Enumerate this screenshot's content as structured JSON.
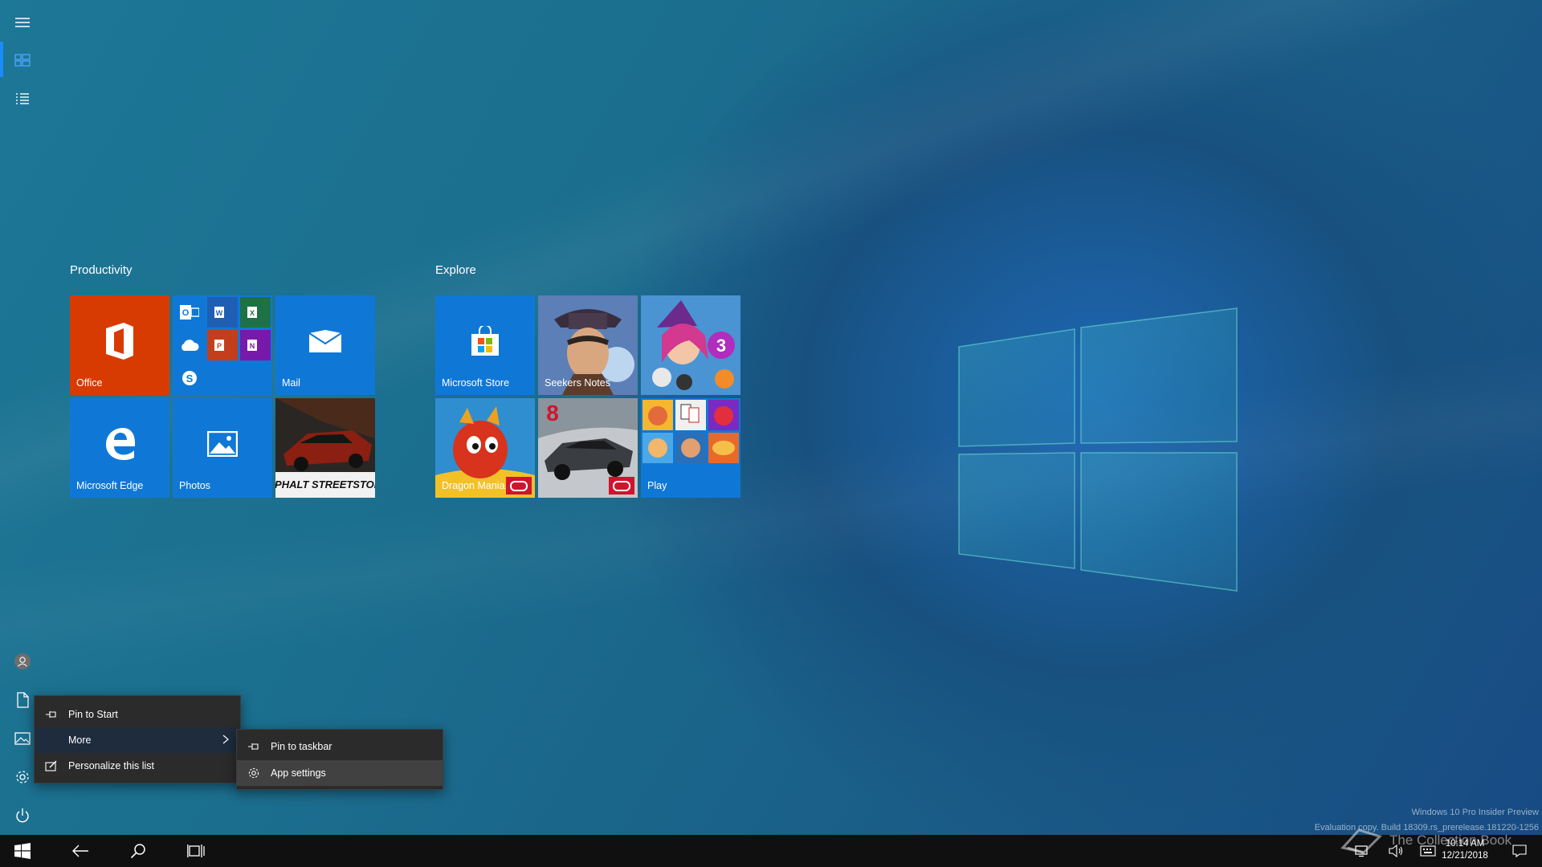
{
  "start_menu": {
    "groups": [
      {
        "title": "Productivity",
        "tiles": [
          {
            "label": "Office",
            "icon": "office-icon",
            "color": "#d83b01"
          },
          {
            "label": "",
            "icon": "office-apps-group-icon",
            "color": "#0f78d7"
          },
          {
            "label": "Mail",
            "icon": "mail-icon",
            "color": "#0f78d7"
          },
          {
            "label": "Microsoft Edge",
            "icon": "edge-icon",
            "color": "#0f78d7"
          },
          {
            "label": "Photos",
            "icon": "photos-icon",
            "color": "#0f78d7"
          },
          {
            "label": "",
            "icon": "asphalt-game-icon",
            "art_text": "ASPHALT STREETSTORM"
          }
        ]
      },
      {
        "title": "Explore",
        "tiles": [
          {
            "label": "Microsoft Store",
            "icon": "store-icon",
            "color": "#0f78d7"
          },
          {
            "label": "Seekers Notes",
            "icon": "seekers-notes-game-icon"
          },
          {
            "label": "",
            "icon": "bubble-witch-game-icon",
            "art_text": "3"
          },
          {
            "label": "Dragon Mania",
            "icon": "dragon-mania-game-icon"
          },
          {
            "label": "",
            "icon": "asphalt8-game-icon",
            "art_text": "8"
          },
          {
            "label": "Play",
            "icon": "play-folder-icon",
            "color": "#0f78d7"
          }
        ]
      }
    ],
    "context_menu": {
      "items": [
        {
          "label": "Pin to Start",
          "icon": "pin-icon"
        },
        {
          "label": "More",
          "icon": "",
          "has_submenu": true
        },
        {
          "label": "Personalize this list",
          "icon": "personalize-icon"
        }
      ],
      "submenu": [
        {
          "label": "Pin to taskbar",
          "icon": "pin-icon"
        },
        {
          "label": "App settings",
          "icon": "gear-icon"
        }
      ]
    }
  },
  "left_rail": [
    "hamburger-icon",
    "pinned-tiles-icon",
    "all-apps-icon",
    "user-avatar-icon",
    "documents-icon",
    "pictures-icon",
    "settings-icon",
    "power-icon"
  ],
  "taskbar": {
    "buttons": [
      "start-icon",
      "back-icon",
      "search-icon",
      "task-view-icon"
    ],
    "tray": [
      "network-icon",
      "volume-icon",
      "keyboard-icon",
      "action-center-icon"
    ],
    "time": "10:14 AM",
    "date": "12/21/2018"
  },
  "watermark": {
    "line1": "Windows 10 Pro Insider Preview",
    "line2": "Evaluation copy. Build 18309.rs_prerelease.181220-1256"
  },
  "brand": "The Collection Book",
  "colors": {
    "accent": "#0f78d7",
    "office": "#d83b01",
    "menu_bg": "#2b2b2b",
    "taskbar": "#101010"
  }
}
